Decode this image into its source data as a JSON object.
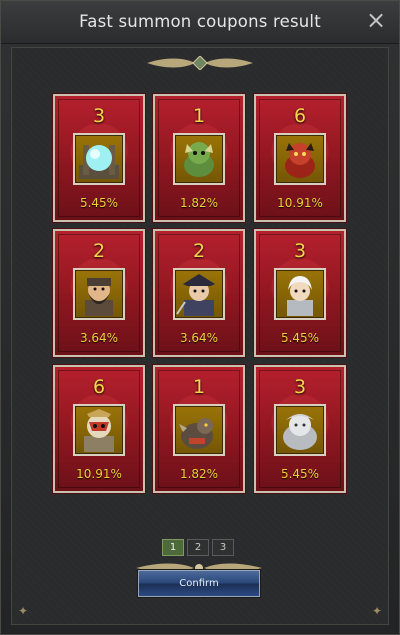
{
  "dialog": {
    "title": "Fast summon coupons result",
    "close_glyph": "×",
    "confirm_label": "Confirm"
  },
  "results": [
    {
      "count": "3",
      "chance": "5.45%",
      "icon": "crystal-orb-icon"
    },
    {
      "count": "1",
      "chance": "1.82%",
      "icon": "green-dragon-icon"
    },
    {
      "count": "6",
      "chance": "10.91%",
      "icon": "red-demon-icon"
    },
    {
      "count": "2",
      "chance": "3.64%",
      "icon": "bearded-warrior-icon"
    },
    {
      "count": "2",
      "chance": "3.64%",
      "icon": "dark-knight-icon"
    },
    {
      "count": "3",
      "chance": "5.45%",
      "icon": "white-haired-hero-icon"
    },
    {
      "count": "6",
      "chance": "10.91%",
      "icon": "masked-warrior-icon"
    },
    {
      "count": "1",
      "chance": "1.82%",
      "icon": "armored-beast-icon"
    },
    {
      "count": "3",
      "chance": "5.45%",
      "icon": "pale-ghost-icon"
    }
  ],
  "pagination": {
    "pages": [
      "1",
      "2",
      "3"
    ],
    "current": "1"
  },
  "colors": {
    "card_red": "#a11c28",
    "count_gold": "#f6d54a",
    "portrait_gold": "#8a6706",
    "confirm_blue": "#2b4a83",
    "active_page_green": "#4d6a3b"
  }
}
